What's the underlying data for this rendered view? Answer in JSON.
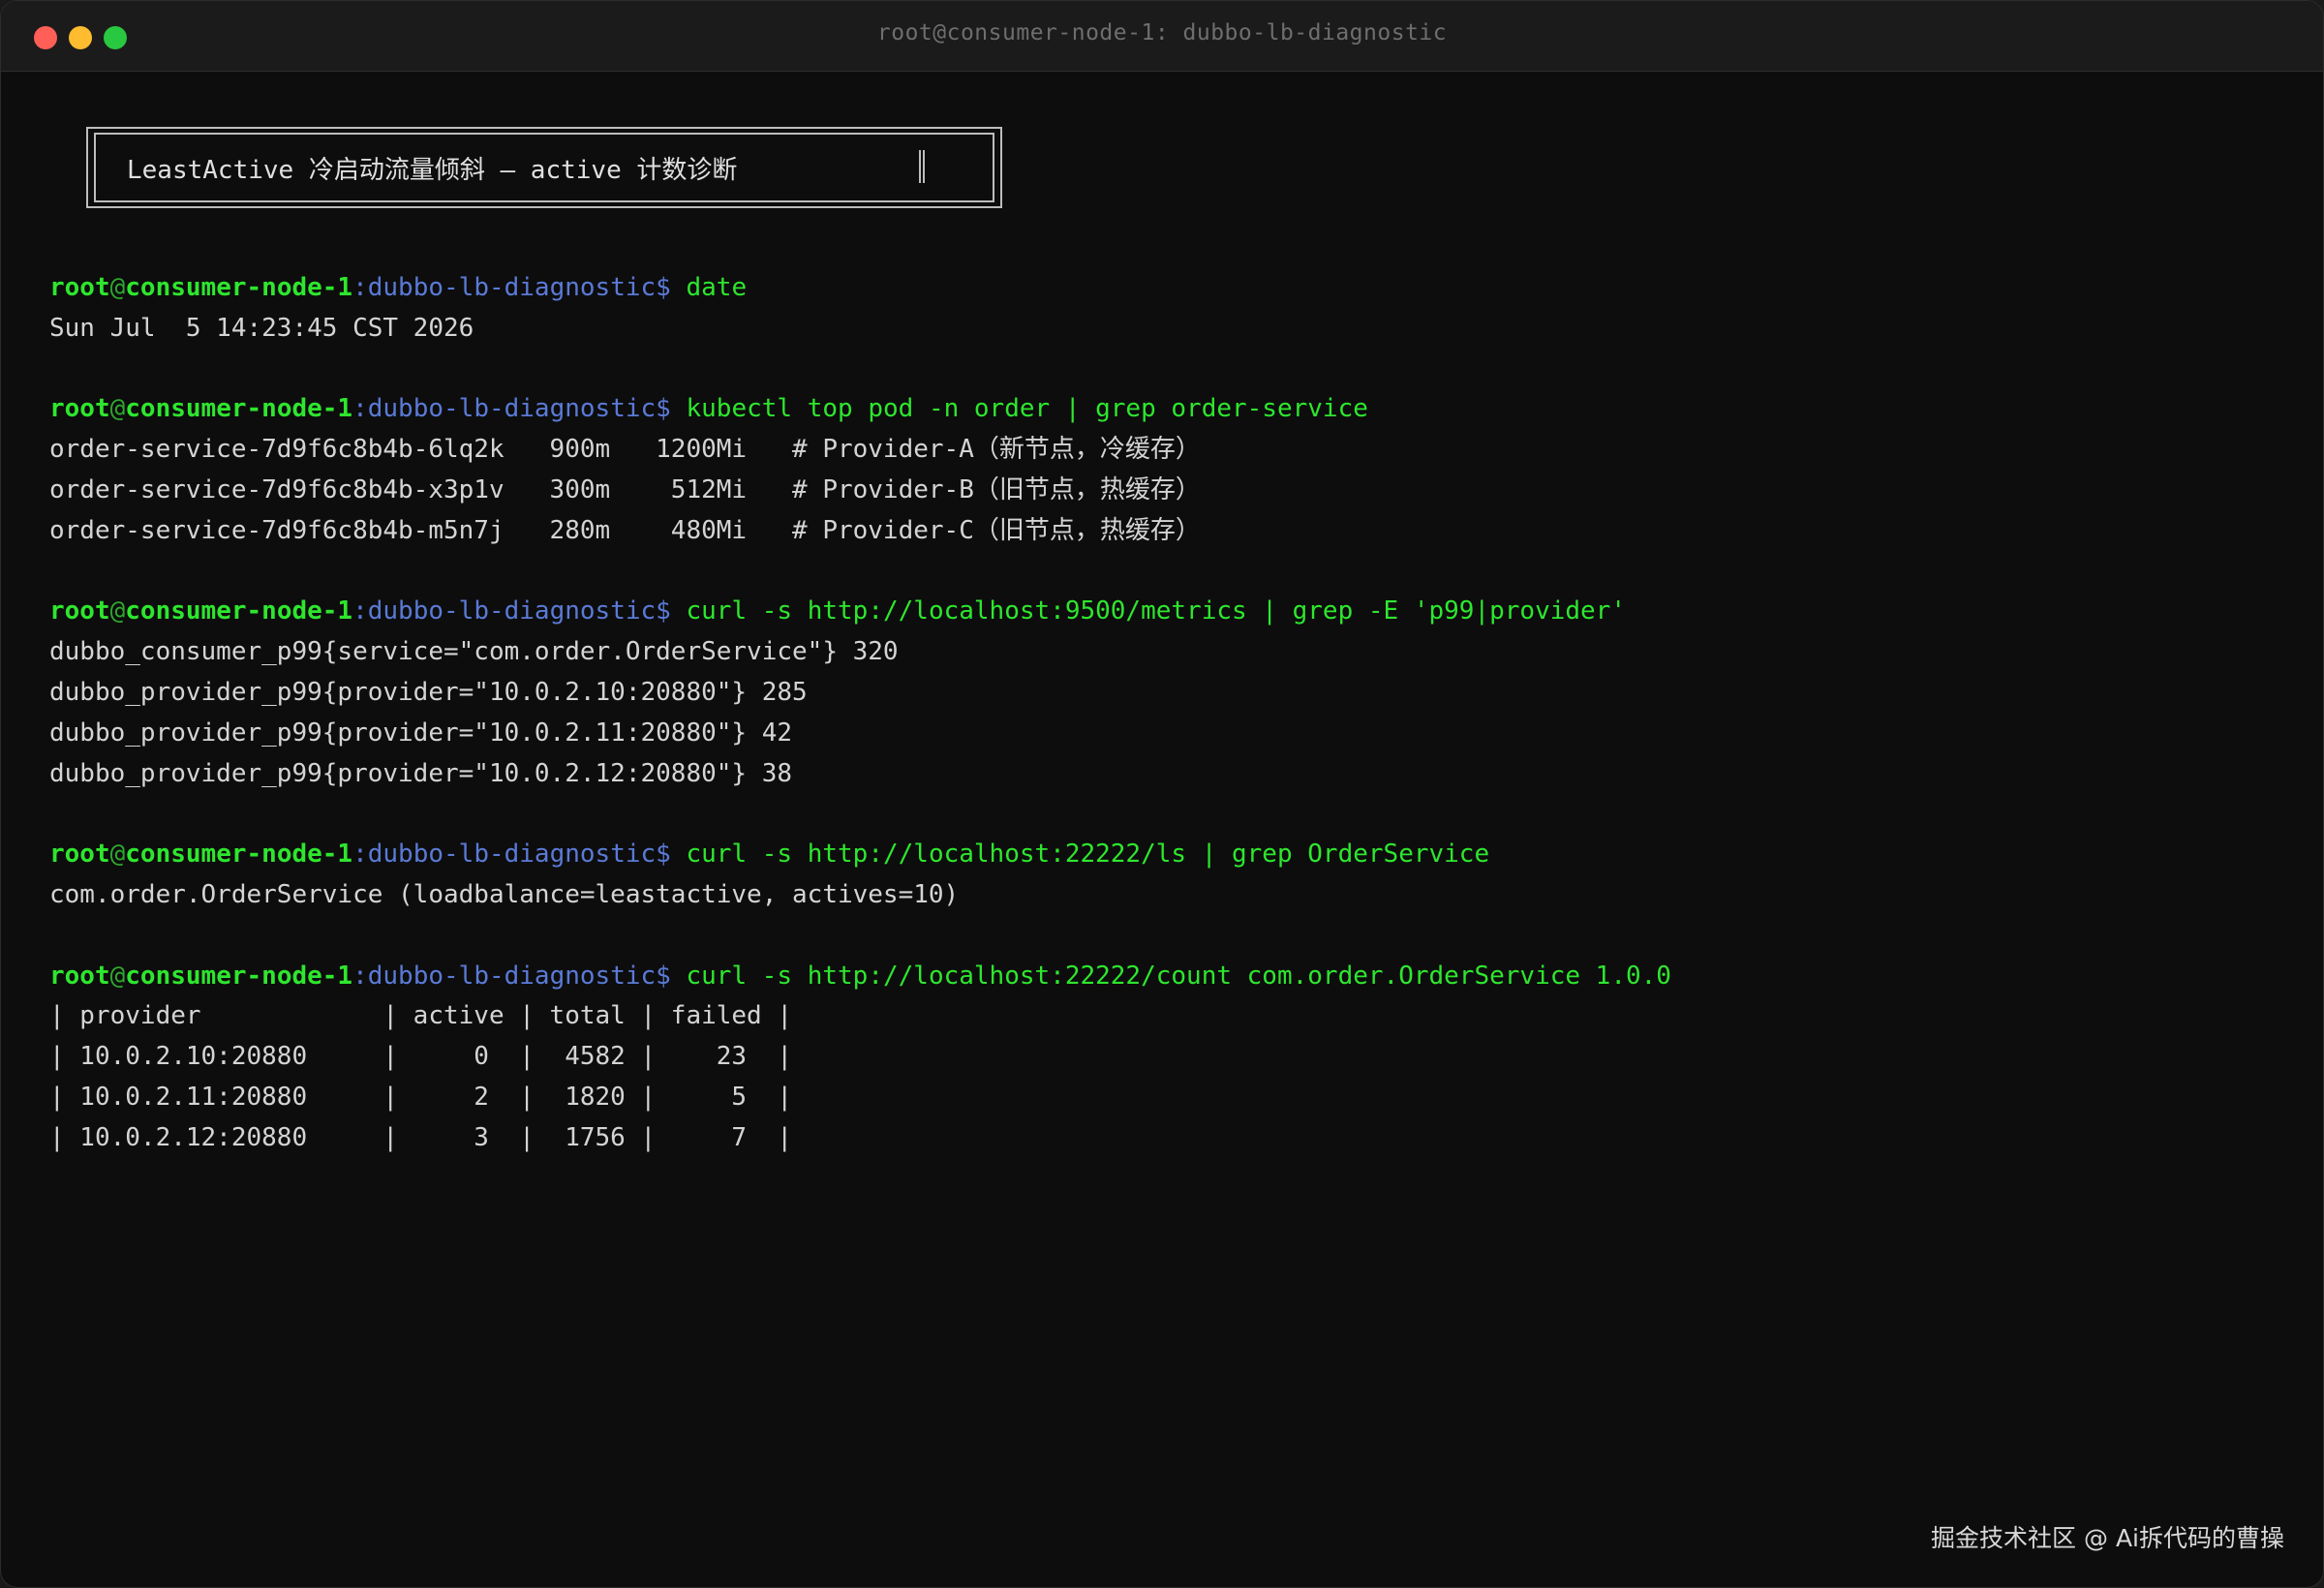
{
  "window": {
    "title": "root@consumer-node-1: dubbo-lb-diagnostic"
  },
  "banner": {
    "text": "LeastActive 冷启动流量倾斜 — active 计数诊断"
  },
  "prompt": {
    "user": "root",
    "at": "@",
    "host": "consumer-node-1",
    "path": ":dubbo-lb-diagnostic",
    "symbol": "$"
  },
  "blocks": [
    {
      "command": "date",
      "output": [
        "Sun Jul  5 14:23:45 CST 2026"
      ]
    },
    {
      "command": "kubectl top pod -n order | grep order-service",
      "output": [
        "order-service-7d9f6c8b4b-6lq2k   900m   1200Mi   # Provider-A（新节点，冷缓存）",
        "order-service-7d9f6c8b4b-x3p1v   300m    512Mi   # Provider-B（旧节点，热缓存）",
        "order-service-7d9f6c8b4b-m5n7j   280m    480Mi   # Provider-C（旧节点，热缓存）"
      ]
    },
    {
      "command": "curl -s http://localhost:9500/metrics | grep -E 'p99|provider'",
      "output": [
        "dubbo_consumer_p99{service=\"com.order.OrderService\"} 320",
        "dubbo_provider_p99{provider=\"10.0.2.10:20880\"} 285",
        "dubbo_provider_p99{provider=\"10.0.2.11:20880\"} 42",
        "dubbo_provider_p99{provider=\"10.0.2.12:20880\"} 38"
      ]
    },
    {
      "command": "curl -s http://localhost:22222/ls | grep OrderService",
      "output": [
        "com.order.OrderService (loadbalance=leastactive, actives=10)"
      ]
    },
    {
      "command": "curl -s http://localhost:22222/count com.order.OrderService 1.0.0",
      "output": [
        "| provider            | active | total | failed |",
        "| 10.0.2.10:20880     |     0  |  4582 |    23  |",
        "| 10.0.2.11:20880     |     2  |  1820 |     5  |",
        "| 10.0.2.12:20880     |     3  |  1756 |     7  |"
      ]
    }
  ],
  "watermark": "掘金技术社区 @ Ai拆代码的曹操",
  "colors": {
    "user": "#2ee62e",
    "path": "#5a7ad6",
    "command": "#2ee62e",
    "output": "#d4d4d4",
    "background": "#0d0d0d"
  }
}
